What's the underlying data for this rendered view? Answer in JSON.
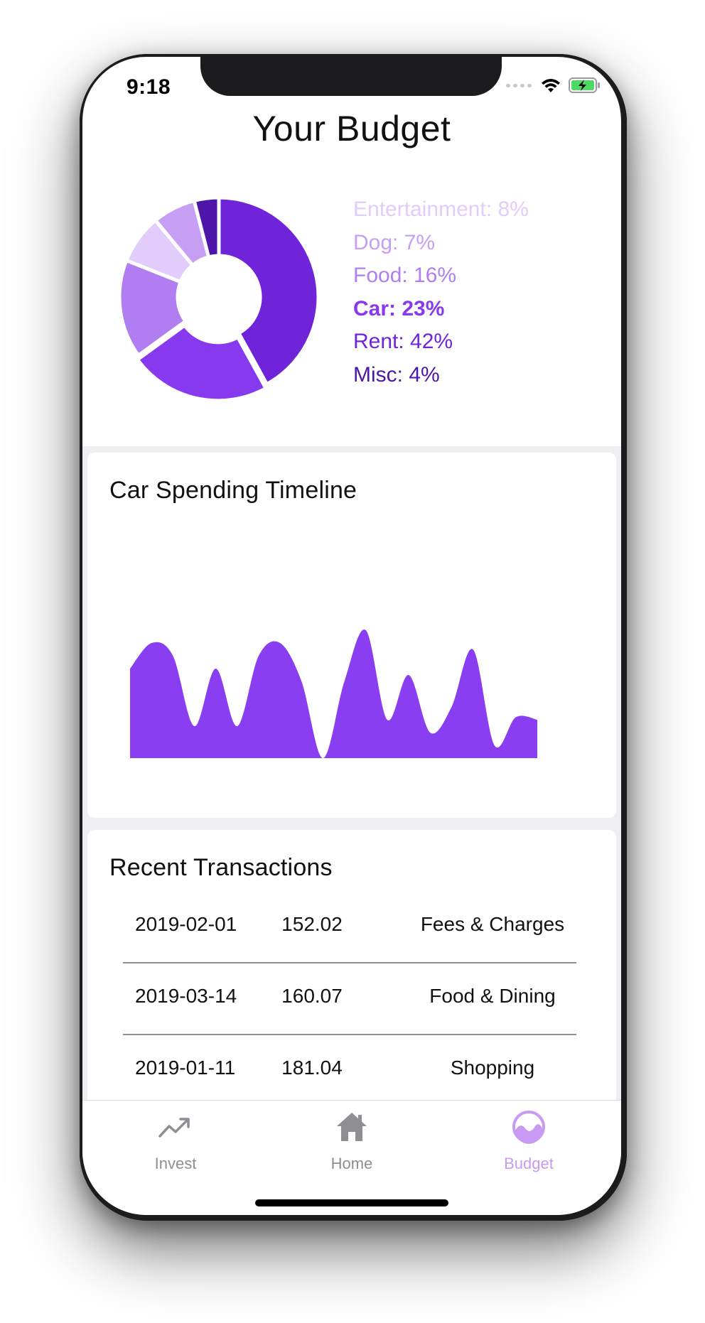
{
  "status_bar": {
    "time": "9:18"
  },
  "page_title": "Your Budget",
  "budget": {
    "segments": [
      {
        "label": "Entertainment: 8%",
        "name": "Entertainment",
        "percent": 8,
        "color": "#e2ccfb",
        "bold": false
      },
      {
        "label": "Dog: 7%",
        "name": "Dog",
        "percent": 7,
        "color": "#c69ff5",
        "bold": false
      },
      {
        "label": "Food: 16%",
        "name": "Food",
        "percent": 16,
        "color": "#b17ef1",
        "bold": false
      },
      {
        "label": "Car: 23%",
        "name": "Car",
        "percent": 23,
        "color": "#8739f0",
        "bold": true
      },
      {
        "label": "Rent: 42%",
        "name": "Rent",
        "percent": 42,
        "color": "#6f24da",
        "bold": false
      },
      {
        "label": "Misc: 4%",
        "name": "Misc",
        "percent": 4,
        "color": "#4e16a8",
        "bold": false
      }
    ],
    "pie_order": [
      "Rent",
      "Car",
      "Food",
      "Entertainment",
      "Dog",
      "Misc"
    ],
    "exploded_segment": "Car"
  },
  "timeline": {
    "title": "Car Spending Timeline",
    "color": "#8a3ef2",
    "chart_data": {
      "type": "area",
      "title": "Car Spending Timeline",
      "xlabel": "",
      "ylabel": "",
      "grid": false,
      "ylim": [
        0,
        100
      ],
      "values": [
        70,
        90,
        80,
        25,
        70,
        25,
        80,
        90,
        60,
        0,
        60,
        100,
        30,
        65,
        20,
        40,
        85,
        10,
        32,
        30
      ]
    }
  },
  "transactions": {
    "title": "Recent Transactions",
    "rows": [
      {
        "date": "2019-02-01",
        "amount": "152.02",
        "category": "Fees & Charges"
      },
      {
        "date": "2019-03-14",
        "amount": "160.07",
        "category": "Food & Dining"
      },
      {
        "date": "2019-01-11",
        "amount": "181.04",
        "category": "Shopping"
      }
    ]
  },
  "tabs": [
    {
      "label": "Invest",
      "icon": "trend-up-icon",
      "active": false,
      "color": "#8e8e93"
    },
    {
      "label": "Home",
      "icon": "house-icon",
      "active": false,
      "color": "#8e8e93"
    },
    {
      "label": "Budget",
      "icon": "budget-wave-icon",
      "active": true,
      "color": "#c99af3"
    }
  ]
}
